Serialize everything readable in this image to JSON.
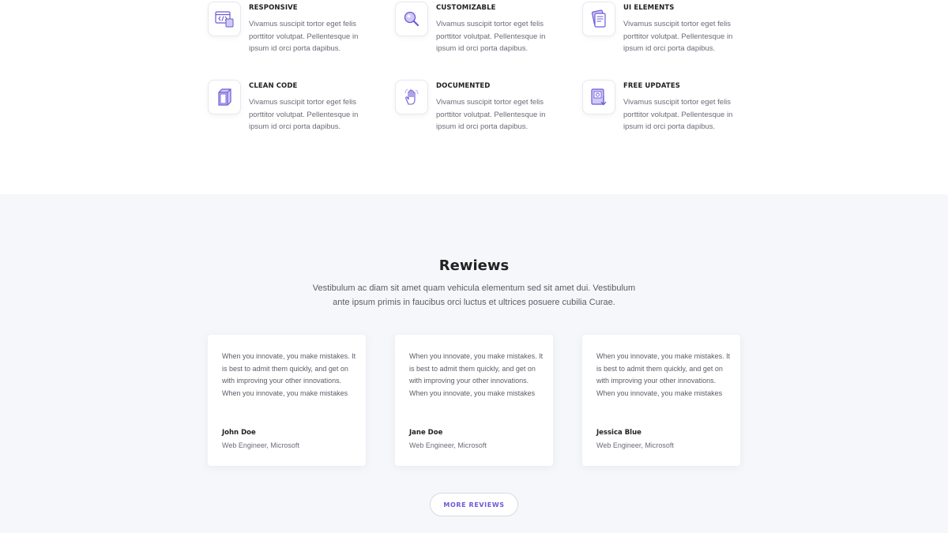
{
  "features": [
    {
      "title": "RESPONSIVE",
      "description": "Vivamus suscipit tortor eget felis porttitor volutpat. Pellentesque in ipsum id orci porta dapibus.",
      "icon": "code-window-icon"
    },
    {
      "title": "CUSTOMIZABLE",
      "description": "Vivamus suscipit tortor eget felis porttitor volutpat. Pellentesque in ipsum id orci porta dapibus.",
      "icon": "magnifier-icon"
    },
    {
      "title": "UI ELEMENTS",
      "description": "Vivamus suscipit tortor eget felis porttitor volutpat. Pellentesque in ipsum id orci porta dapibus.",
      "icon": "layers-icon"
    },
    {
      "title": "CLEAN CODE",
      "description": "Vivamus suscipit tortor eget felis porttitor volutpat. Pellentesque in ipsum id orci porta dapibus.",
      "icon": "box-icon"
    },
    {
      "title": "DOCUMENTED",
      "description": "Vivamus suscipit tortor eget felis porttitor volutpat. Pellentesque in ipsum id orci porta dapibus.",
      "icon": "hand-gesture-icon"
    },
    {
      "title": "FREE UPDATES",
      "description": "Vivamus suscipit tortor eget felis porttitor volutpat. Pellentesque in ipsum id orci porta dapibus.",
      "icon": "download-document-icon"
    }
  ],
  "reviews": {
    "title": "Rewiews",
    "subtitle": "Vestibulum ac diam sit amet quam vehicula elementum sed sit amet dui. Vestibulum ante ipsum primis in faucibus orci luctus et ultrices posuere cubilia Curae.",
    "cards": [
      {
        "quote": "When you innovate, you make mistakes. It is best to admit them quickly, and get on with improving your other innovations. When you innovate, you make mistakes",
        "name": "John Doe",
        "role": "Web Engineer, Microsoft"
      },
      {
        "quote": "When you innovate, you make mistakes. It is best to admit them quickly, and get on with improving your other innovations. When you innovate, you make mistakes",
        "name": "Jane Doe",
        "role": "Web Engineer, Microsoft"
      },
      {
        "quote": "When you innovate, you make mistakes. It is best to admit them quickly, and get on with improving your other innovations. When you innovate, you make mistakes",
        "name": "Jessica Blue",
        "role": "Web Engineer, Microsoft"
      }
    ],
    "more_label": "MORE REVIEWS"
  },
  "colors": {
    "accent": "#6a5ad6",
    "icon_light": "#b7b0f0",
    "section_bg": "#f6f7fa"
  }
}
